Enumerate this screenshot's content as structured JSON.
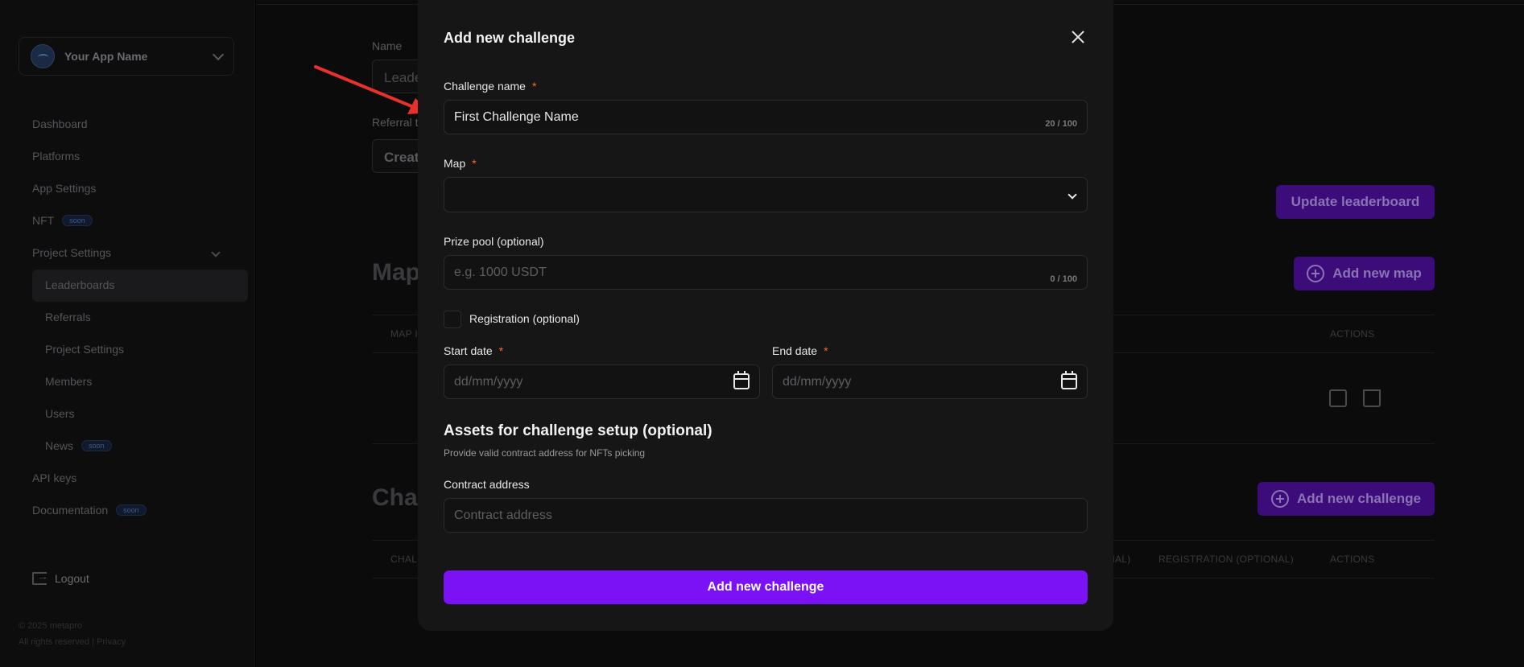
{
  "sidebar": {
    "app_name": "Your App Name",
    "items": [
      {
        "label": "Dashboard"
      },
      {
        "label": "Platforms"
      },
      {
        "label": "App Settings"
      },
      {
        "label": "NFT",
        "badge": "soon"
      },
      {
        "label": "Project Settings"
      },
      {
        "label": "Leaderboards"
      },
      {
        "label": "Referrals"
      },
      {
        "label": "Project Settings"
      },
      {
        "label": "Members"
      },
      {
        "label": "Users"
      },
      {
        "label": "News",
        "badge": "soon"
      },
      {
        "label": "API keys"
      },
      {
        "label": "Documentation",
        "badge": "soon"
      }
    ],
    "logout": "Logout",
    "footer_copy": "© 2025 metapro",
    "footer_rights": "All rights reserved | Privacy"
  },
  "background": {
    "name_label": "Name",
    "name_value": "Leade",
    "referral_label": "Referral t",
    "referral_value": "Creat",
    "maps_heading": "Map",
    "challenges_heading": "Chal",
    "update_button": "Update leaderboard",
    "add_map_button": "Add new map",
    "add_challenge_button": "Add new challenge",
    "maps_table_headers": [
      "MAP I",
      "ACTIONS"
    ],
    "challenges_table_headers": [
      "CHAL",
      "NAL)",
      "REGISTRATION (OPTIONAL)",
      "ACTIONS"
    ]
  },
  "modal": {
    "title": "Add new challenge",
    "challenge_name": {
      "label": "Challenge name",
      "required": "*",
      "value": "First Challenge Name",
      "counter": "20 / 100"
    },
    "map": {
      "label": "Map",
      "required": "*",
      "value": ""
    },
    "prize_pool": {
      "label": "Prize pool (optional)",
      "placeholder": "e.g. 1000 USDT",
      "counter": "0 / 100"
    },
    "registration": {
      "label": "Registration (optional)"
    },
    "start_date": {
      "label": "Start date",
      "required": "*",
      "placeholder": "dd/mm/yyyy"
    },
    "end_date": {
      "label": "End date",
      "required": "*",
      "placeholder": "dd/mm/yyyy"
    },
    "assets_heading": "Assets for challenge setup (optional)",
    "assets_description": "Provide valid contract address for NFTs picking",
    "contract": {
      "label": "Contract address",
      "placeholder": "Contract address"
    },
    "submit": "Add new challenge"
  },
  "colors": {
    "accent": "#7b12f5",
    "required": "#ff6a2a",
    "annotation_arrow": "#e8312a"
  }
}
